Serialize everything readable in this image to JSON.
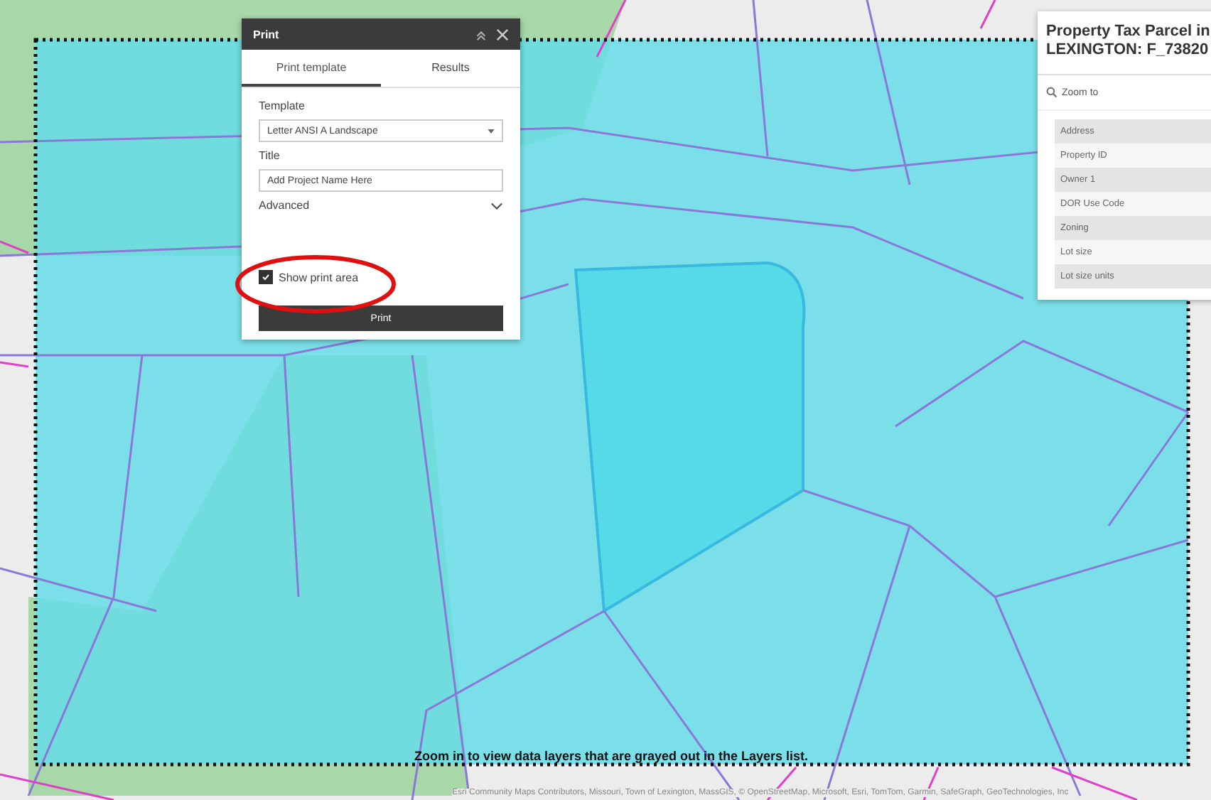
{
  "print_panel": {
    "title": "Print",
    "tabs": [
      {
        "label": "Print template",
        "selected": true
      },
      {
        "label": "Results",
        "selected": false
      }
    ],
    "template_label": "Template",
    "template_value": "Letter ANSI A Landscape",
    "title_label": "Title",
    "title_value": "Add Project Name Here",
    "advanced_label": "Advanced",
    "advanced_expanded": false,
    "show_print_area": {
      "label": "Show print area",
      "checked": true
    },
    "print_button": "Print"
  },
  "popup": {
    "title": "Property Tax Parcel in LEXINGTON: F_73820",
    "zoom_to": "Zoom to",
    "fields": [
      "Address",
      "Property ID",
      "Owner 1",
      "DOR Use Code",
      "Zoning",
      "Lot size",
      "Lot size units"
    ]
  },
  "map": {
    "show_print_area": true,
    "notice": "Zoom in to view data layers that are grayed out in the Layers list.",
    "attribution": "Esri Community Maps Contributors, Missouri, Town of Lexington, MassGIS, © OpenStreetMap, Microsoft, Esri, TomTom, Garmin, SafeGraph, GeoTechnologies, Inc"
  }
}
